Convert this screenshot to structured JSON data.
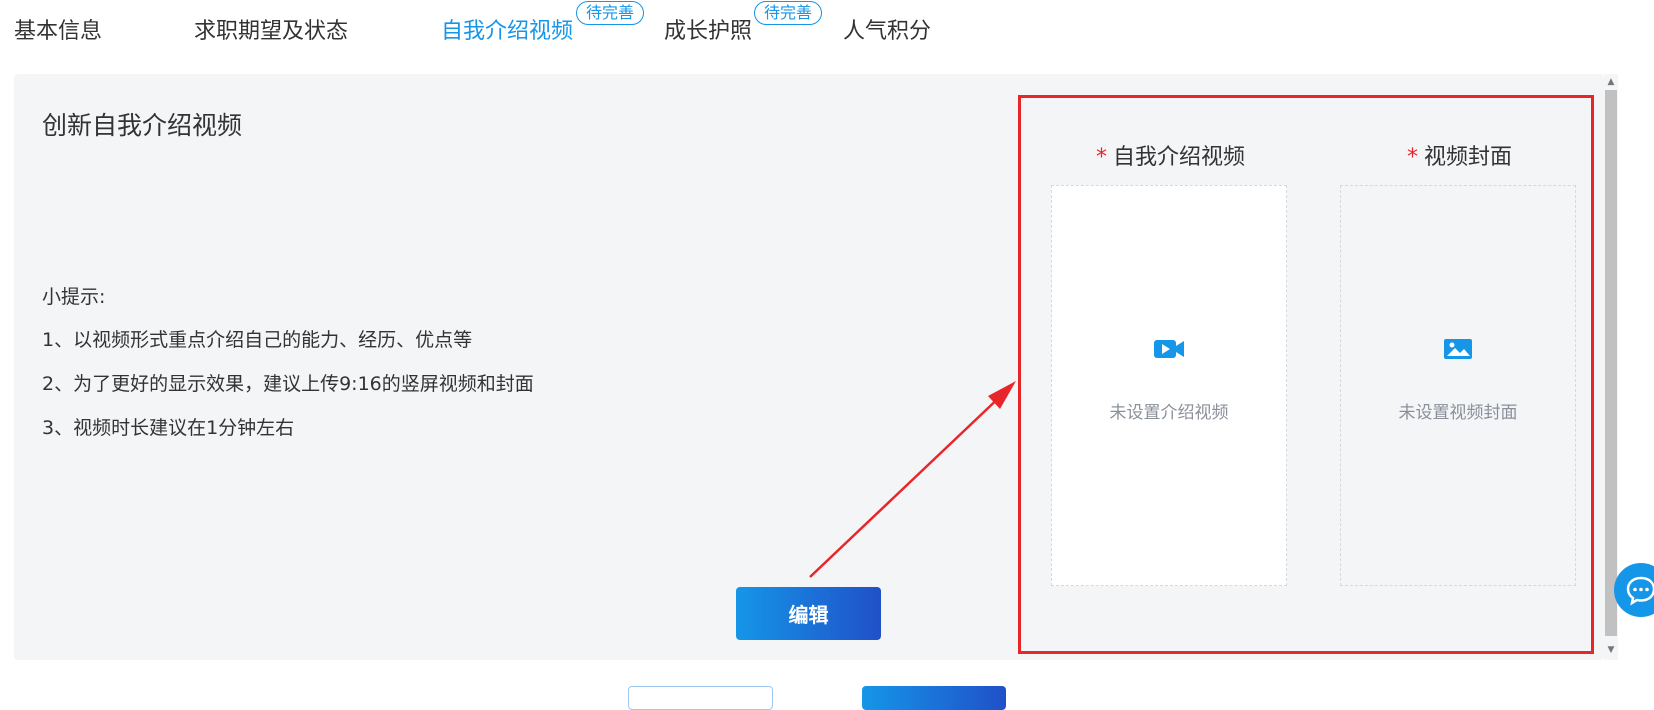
{
  "tabs": [
    {
      "label": "基本信息",
      "active": false
    },
    {
      "label": "求职期望及状态",
      "active": false
    },
    {
      "label": "自我介绍视频",
      "active": true,
      "badge": "待完善"
    },
    {
      "label": "成长护照",
      "active": false,
      "badge": "待完善"
    },
    {
      "label": "人气积分",
      "active": false
    }
  ],
  "panel": {
    "title": "创新自我介绍视频",
    "tips_title": "小提示:",
    "tips": [
      "1、以视频形式重点介绍自己的能力、经历、优点等",
      "2、为了更好的显示效果，建议上传9:16的竖屏视频和封面",
      "3、视频时长建议在1分钟左右"
    ],
    "edit_label": "编辑"
  },
  "upload": {
    "required_mark": "*",
    "video_label": "自我介绍视频",
    "video_hint": "未设置介绍视频",
    "cover_label": "视频封面",
    "cover_hint": "未设置视频封面"
  },
  "icons": {
    "video": "video-camera-icon",
    "cover": "image-icon",
    "chat": "chat-bubble-icon"
  },
  "colors": {
    "accent": "#1596e8",
    "annotation_red": "#e8262a"
  }
}
